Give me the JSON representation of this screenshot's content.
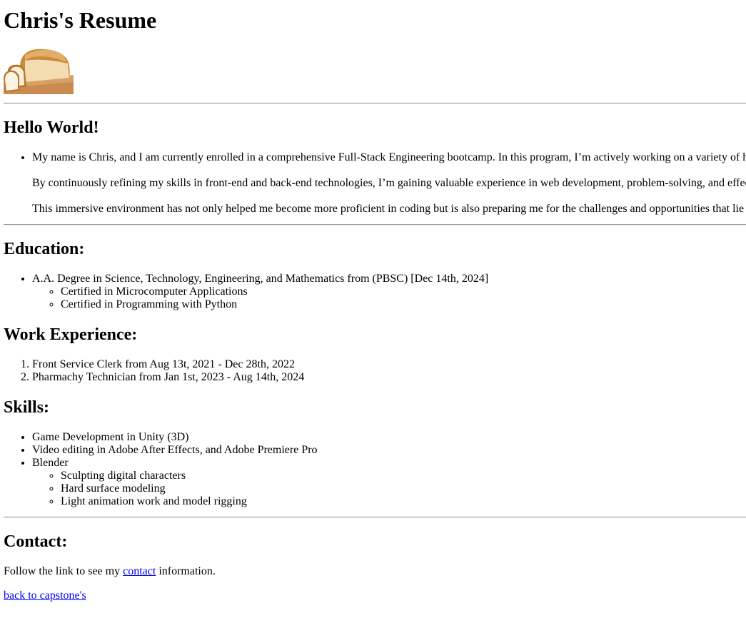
{
  "title": "Chris's Resume",
  "image_alt": "bread",
  "hello": {
    "heading": "Hello World!",
    "paragraphs": [
      "My name is Chris, and I am currently enrolled in a comprehensive Full-Stack Engineering bootcamp. In this program, I’m actively working on a variety of h",
      "By continuously refining my skills in front-end and back-end technologies, I’m gaining valuable experience in web development, problem-solving, and effec",
      "This immersive environment has not only helped me become more proficient in coding but is also preparing me for the challenges and opportunities that lie"
    ]
  },
  "education": {
    "heading": "Education:",
    "degree": "A.A. Degree in Science, Technology, Engineering, and Mathematics from (PBSC) [Dec 14th, 2024]",
    "certs": [
      "Certified in Microcomputer Applications",
      "Certified in Programming with Python"
    ]
  },
  "work": {
    "heading": "Work Experience:",
    "items": [
      "Front Service Clerk from Aug 13t, 2021 - Dec 28th, 2022",
      "Pharmachy Technician from Jan 1st, 2023 - Aug 14th, 2024"
    ]
  },
  "skills": {
    "heading": "Skills:",
    "items": [
      "Game Development in Unity (3D)",
      "Video editing in Adobe After Effects, and Adobe Premiere Pro",
      "Blender"
    ],
    "blender_sub": [
      "Sculpting digital characters",
      "Hard surface modeling",
      "Light animation work and model rigging"
    ]
  },
  "contact": {
    "heading": "Contact:",
    "text_before": "Follow the link to see my ",
    "link_label": "contact",
    "text_after": " information.",
    "back_link": "back to capstone's"
  }
}
